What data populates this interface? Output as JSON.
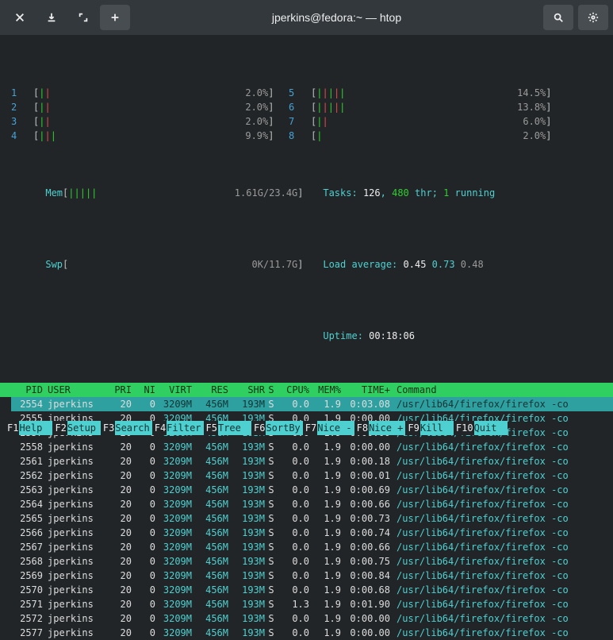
{
  "titlebar": {
    "title": "jperkins@fedora:~ — htop"
  },
  "cpus_left": [
    {
      "n": "1",
      "bar": "||",
      "pct": "2.0%"
    },
    {
      "n": "2",
      "bar": "||",
      "pct": "2.0%"
    },
    {
      "n": "3",
      "bar": "||",
      "pct": "2.0%"
    },
    {
      "n": "4",
      "bar": "|||",
      "pct": "9.9%"
    }
  ],
  "cpus_right": [
    {
      "n": "5",
      "bar": "|||||",
      "pct": "14.5%"
    },
    {
      "n": "6",
      "bar": "|||||",
      "pct": "13.8%"
    },
    {
      "n": "7",
      "bar": "||",
      "pct": "6.0%"
    },
    {
      "n": "8",
      "bar": "|",
      "pct": "2.0%"
    }
  ],
  "mem": {
    "label": "Mem",
    "bar": "|||||",
    "val": "1.61G/23.4G"
  },
  "swp": {
    "label": "Swp",
    "bar": "",
    "val": "0K/11.7G"
  },
  "tasks": {
    "label": "Tasks:",
    "procs": "126",
    "sep": ",",
    "thr": "480",
    "thrlbl": "thr;",
    "run": "1",
    "runlbl": "running"
  },
  "load": {
    "label": "Load average:",
    "v1": "0.45",
    "v2": "0.73",
    "v3": "0.48"
  },
  "uptime": {
    "label": "Uptime:",
    "val": "00:18:06"
  },
  "headers": {
    "pid": "PID",
    "user": "USER",
    "pri": "PRI",
    "ni": "NI",
    "virt": "VIRT",
    "res": "RES",
    "shr": "SHR",
    "s": "S",
    "cpu": "CPU%",
    "mem": "MEM%",
    "time": "TIME+",
    "cmd": "Command"
  },
  "procs": [
    {
      "pid": "2554",
      "user": "jperkins",
      "pri": "20",
      "ni": "0",
      "virt": "3209M",
      "res": "456M",
      "shr": "193M",
      "s": "S",
      "cpu": "0.0",
      "mem": "1.9",
      "time": "0:03.08",
      "cmd": "/usr/lib64/firefox/firefox -co",
      "sel": true
    },
    {
      "pid": "2555",
      "user": "jperkins",
      "pri": "20",
      "ni": "0",
      "virt": "3209M",
      "res": "456M",
      "shr": "193M",
      "s": "S",
      "cpu": "0.0",
      "mem": "1.9",
      "time": "0:00.00",
      "cmd": "/usr/lib64/firefox/firefox -co"
    },
    {
      "pid": "2557",
      "user": "jperkins",
      "pri": "20",
      "ni": "0",
      "virt": "3209M",
      "res": "456M",
      "shr": "193M",
      "s": "S",
      "cpu": "0.0",
      "mem": "1.9",
      "time": "0:00.00",
      "cmd": "/usr/lib64/firefox/firefox -co"
    },
    {
      "pid": "2558",
      "user": "jperkins",
      "pri": "20",
      "ni": "0",
      "virt": "3209M",
      "res": "456M",
      "shr": "193M",
      "s": "S",
      "cpu": "0.0",
      "mem": "1.9",
      "time": "0:00.00",
      "cmd": "/usr/lib64/firefox/firefox -co"
    },
    {
      "pid": "2561",
      "user": "jperkins",
      "pri": "20",
      "ni": "0",
      "virt": "3209M",
      "res": "456M",
      "shr": "193M",
      "s": "S",
      "cpu": "0.0",
      "mem": "1.9",
      "time": "0:00.18",
      "cmd": "/usr/lib64/firefox/firefox -co"
    },
    {
      "pid": "2562",
      "user": "jperkins",
      "pri": "20",
      "ni": "0",
      "virt": "3209M",
      "res": "456M",
      "shr": "193M",
      "s": "S",
      "cpu": "0.0",
      "mem": "1.9",
      "time": "0:00.01",
      "cmd": "/usr/lib64/firefox/firefox -co"
    },
    {
      "pid": "2563",
      "user": "jperkins",
      "pri": "20",
      "ni": "0",
      "virt": "3209M",
      "res": "456M",
      "shr": "193M",
      "s": "S",
      "cpu": "0.0",
      "mem": "1.9",
      "time": "0:00.69",
      "cmd": "/usr/lib64/firefox/firefox -co"
    },
    {
      "pid": "2564",
      "user": "jperkins",
      "pri": "20",
      "ni": "0",
      "virt": "3209M",
      "res": "456M",
      "shr": "193M",
      "s": "S",
      "cpu": "0.0",
      "mem": "1.9",
      "time": "0:00.66",
      "cmd": "/usr/lib64/firefox/firefox -co"
    },
    {
      "pid": "2565",
      "user": "jperkins",
      "pri": "20",
      "ni": "0",
      "virt": "3209M",
      "res": "456M",
      "shr": "193M",
      "s": "S",
      "cpu": "0.0",
      "mem": "1.9",
      "time": "0:00.73",
      "cmd": "/usr/lib64/firefox/firefox -co"
    },
    {
      "pid": "2566",
      "user": "jperkins",
      "pri": "20",
      "ni": "0",
      "virt": "3209M",
      "res": "456M",
      "shr": "193M",
      "s": "S",
      "cpu": "0.0",
      "mem": "1.9",
      "time": "0:00.74",
      "cmd": "/usr/lib64/firefox/firefox -co"
    },
    {
      "pid": "2567",
      "user": "jperkins",
      "pri": "20",
      "ni": "0",
      "virt": "3209M",
      "res": "456M",
      "shr": "193M",
      "s": "S",
      "cpu": "0.0",
      "mem": "1.9",
      "time": "0:00.66",
      "cmd": "/usr/lib64/firefox/firefox -co"
    },
    {
      "pid": "2568",
      "user": "jperkins",
      "pri": "20",
      "ni": "0",
      "virt": "3209M",
      "res": "456M",
      "shr": "193M",
      "s": "S",
      "cpu": "0.0",
      "mem": "1.9",
      "time": "0:00.75",
      "cmd": "/usr/lib64/firefox/firefox -co"
    },
    {
      "pid": "2569",
      "user": "jperkins",
      "pri": "20",
      "ni": "0",
      "virt": "3209M",
      "res": "456M",
      "shr": "193M",
      "s": "S",
      "cpu": "0.0",
      "mem": "1.9",
      "time": "0:00.84",
      "cmd": "/usr/lib64/firefox/firefox -co"
    },
    {
      "pid": "2570",
      "user": "jperkins",
      "pri": "20",
      "ni": "0",
      "virt": "3209M",
      "res": "456M",
      "shr": "193M",
      "s": "S",
      "cpu": "0.0",
      "mem": "1.9",
      "time": "0:00.68",
      "cmd": "/usr/lib64/firefox/firefox -co"
    },
    {
      "pid": "2571",
      "user": "jperkins",
      "pri": "20",
      "ni": "0",
      "virt": "3209M",
      "res": "456M",
      "shr": "193M",
      "s": "S",
      "cpu": "1.3",
      "mem": "1.9",
      "time": "0:01.90",
      "cmd": "/usr/lib64/firefox/firefox -co"
    },
    {
      "pid": "2572",
      "user": "jperkins",
      "pri": "20",
      "ni": "0",
      "virt": "3209M",
      "res": "456M",
      "shr": "193M",
      "s": "S",
      "cpu": "0.0",
      "mem": "1.9",
      "time": "0:00.00",
      "cmd": "/usr/lib64/firefox/firefox -co"
    },
    {
      "pid": "2577",
      "user": "jperkins",
      "pri": "20",
      "ni": "0",
      "virt": "3209M",
      "res": "456M",
      "shr": "193M",
      "s": "S",
      "cpu": "0.0",
      "mem": "1.9",
      "time": "0:00.00",
      "cmd": "/usr/lib64/firefox/firefox -co"
    }
  ],
  "footer": [
    {
      "k": "F1",
      "v": "Help"
    },
    {
      "k": "F2",
      "v": "Setup"
    },
    {
      "k": "F3",
      "v": "Search"
    },
    {
      "k": "F4",
      "v": "Filter"
    },
    {
      "k": "F5",
      "v": "Tree"
    },
    {
      "k": "F6",
      "v": "SortBy"
    },
    {
      "k": "F7",
      "v": "Nice -"
    },
    {
      "k": "F8",
      "v": "Nice +"
    },
    {
      "k": "F9",
      "v": "Kill"
    },
    {
      "k": "F10",
      "v": "Quit"
    }
  ]
}
